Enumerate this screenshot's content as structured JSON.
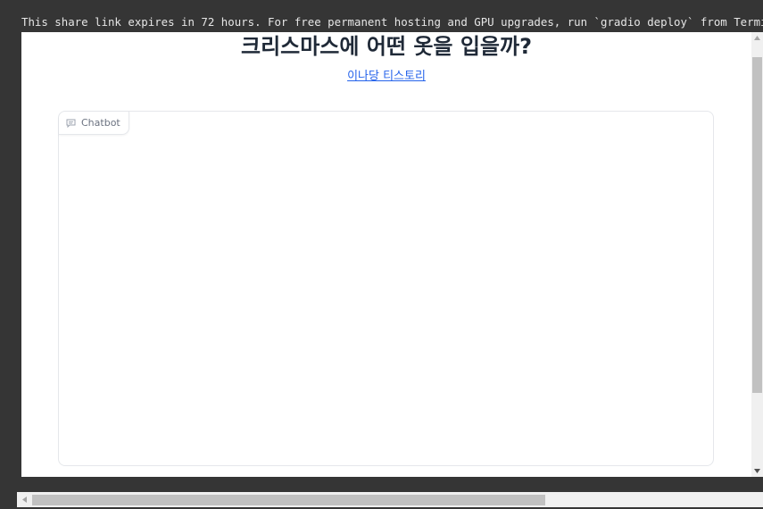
{
  "banner": {
    "text": "This share link expires in 72 hours. For free permanent hosting and GPU upgrades, run `gradio deploy` from Terminal to"
  },
  "header": {
    "title": "크리스마스에 어떤 옷을 입을까?",
    "link_text": "이나당 티스토리"
  },
  "chatbot": {
    "label": "Chatbot",
    "icon": "chat-bubble-icon"
  }
}
